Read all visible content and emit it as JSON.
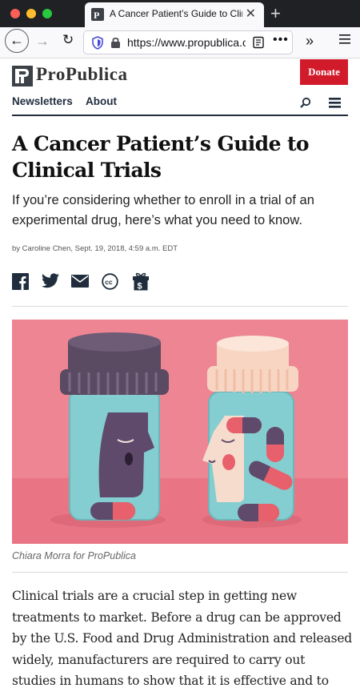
{
  "browser": {
    "tab_title": "A Cancer Patient’s Guide to Clinical Trials",
    "close_label": "✕",
    "new_tab_label": "+",
    "url": "https://www.propublica.org",
    "back_label": "←",
    "forward_label": "→",
    "reload_label": "↻",
    "more_label": "•••",
    "overflow_label": "»"
  },
  "site": {
    "logo_text": "ProPublica",
    "donate_label": "Donate",
    "nav": [
      "Newsletters",
      "About"
    ]
  },
  "article": {
    "headline": "A Cancer Patient’s Guide to Clinical Trials",
    "dek": "If you’re considering whether to enroll in a trial of an experimental drug, here’s what you need to know.",
    "byline": "by Caroline Chen, Sept. 19, 2018, 4:59 a.m. EDT",
    "share_icons": [
      "facebook-icon",
      "twitter-icon",
      "email-icon",
      "creative-commons-icon",
      "gift-icon"
    ],
    "image_credit": "Chiara Morra for ProPublica",
    "body": "Clinical trials are a crucial step in getting new treatments to market. Before a drug can be approved by the U.S. Food and Drug Administration and released widely, manufacturers are required to carry out studies in humans to show that it is effective and to"
  },
  "colors": {
    "brand_red": "#d11a2a",
    "nav_dark": "#1f2d3d",
    "art_background": "#ee8592"
  }
}
